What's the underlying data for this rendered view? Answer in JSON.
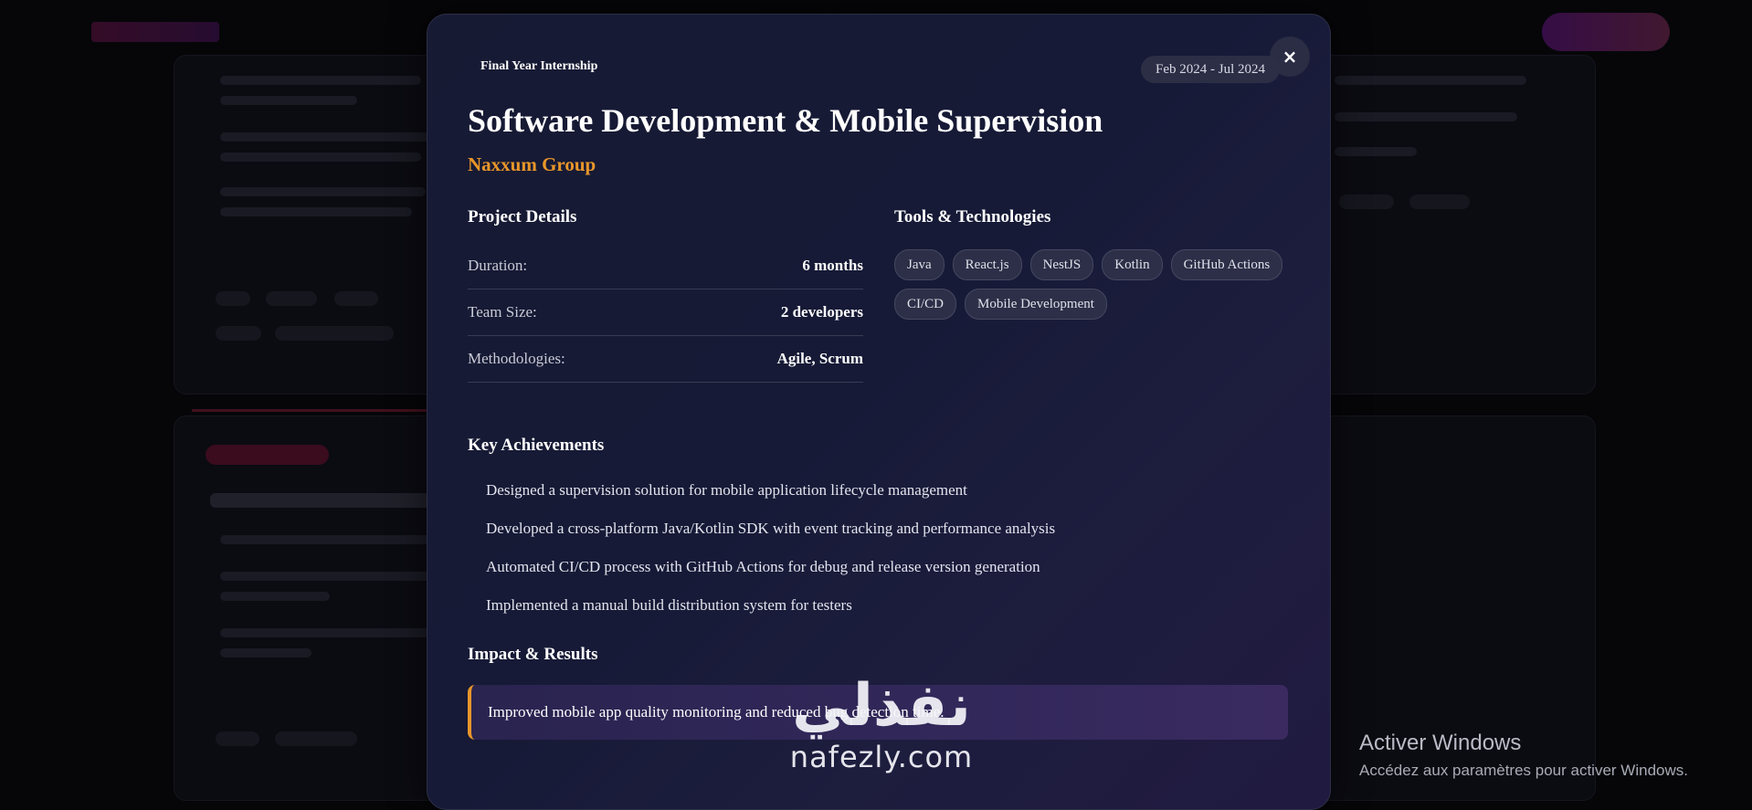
{
  "modal": {
    "kicker": "Final Year Internship",
    "date_range": "Feb 2024 - Jul 2024",
    "close_icon": "×",
    "title": "Software Development & Mobile Supervision",
    "company": "Naxxum Group",
    "project_details": {
      "heading": "Project Details",
      "rows": [
        {
          "label": "Duration:",
          "value": "6 months"
        },
        {
          "label": "Team Size:",
          "value": "2 developers"
        },
        {
          "label": "Methodologies:",
          "value": "Agile, Scrum"
        }
      ]
    },
    "tools": {
      "heading": "Tools & Technologies",
      "tags": [
        "Java",
        "React.js",
        "NestJS",
        "Kotlin",
        "GitHub Actions",
        "CI/CD",
        "Mobile Development"
      ]
    },
    "achievements": {
      "heading": "Key Achievements",
      "items": [
        "Designed a supervision solution for mobile application lifecycle management",
        "Developed a cross-platform Java/Kotlin SDK with event tracking and performance analysis",
        "Automated CI/CD process with GitHub Actions for debug and release version generation",
        "Implemented a manual build distribution system for testers"
      ]
    },
    "impact": {
      "heading": "Impact & Results",
      "text": "Improved mobile app quality monitoring and reduced bug detection time."
    }
  },
  "overlay": {
    "windows_activation_title": "Activer Windows",
    "windows_activation_sub": "Accédez aux paramètres pour activer Windows.",
    "brand_watermark_ar": "نفذلي",
    "brand_watermark_en": "nafezly.com"
  },
  "colors": {
    "accent": "#e8962a",
    "modal_bg": "#171a33",
    "tag_bg": "#2c2f47"
  }
}
